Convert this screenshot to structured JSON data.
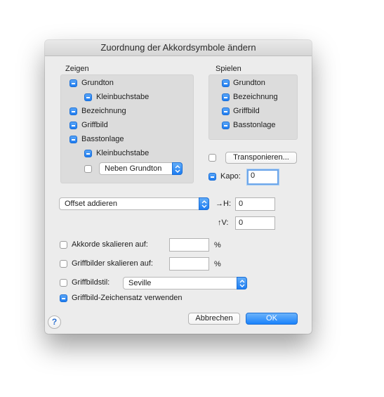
{
  "window": {
    "title": "Zuordnung der Akkordsymbole ändern"
  },
  "zeigen": {
    "heading": "Zeigen",
    "items": [
      {
        "label": "Grundton",
        "checked": true
      },
      {
        "label": "Kleinbuchstabe",
        "checked": true
      },
      {
        "label": "Bezeichnung",
        "checked": true
      },
      {
        "label": "Griffbild",
        "checked": true
      },
      {
        "label": "Basstonlage",
        "checked": true
      },
      {
        "label": "Kleinbuchstabe",
        "checked": true
      }
    ],
    "position_checked": false,
    "position_select": "Neben Grundton"
  },
  "spielen": {
    "heading": "Spielen",
    "items": [
      {
        "label": "Grundton",
        "checked": true
      },
      {
        "label": "Bezeichnung",
        "checked": true
      },
      {
        "label": "Griffbild",
        "checked": true
      },
      {
        "label": "Basstonlage",
        "checked": true
      }
    ]
  },
  "transpose": {
    "checked": false,
    "button_label": "Transponieren..."
  },
  "kapo": {
    "label": "Kapo:",
    "checked": true,
    "value": "0"
  },
  "offset": {
    "select": "Offset addieren",
    "h_label": "→H:",
    "h_value": "0",
    "v_label": "↑V:",
    "v_value": "0"
  },
  "scale_chords": {
    "label": "Akkorde skalieren auf:",
    "checked": false,
    "value": "",
    "unit": "%"
  },
  "scale_diagrams": {
    "label": "Griffbilder skalieren auf:",
    "checked": false,
    "value": "",
    "unit": "%"
  },
  "diagram_style": {
    "label": "Griffbildstil:",
    "checked": false,
    "select": "Seville"
  },
  "diagram_font": {
    "label": "Griffbild-Zeichensatz verwenden",
    "checked": true
  },
  "buttons": {
    "cancel": "Abbrechen",
    "ok": "OK",
    "help": "?"
  },
  "colors": {
    "accent": "#1f7cf0",
    "panel": "#dcdcdc",
    "dialog": "#ececec"
  }
}
